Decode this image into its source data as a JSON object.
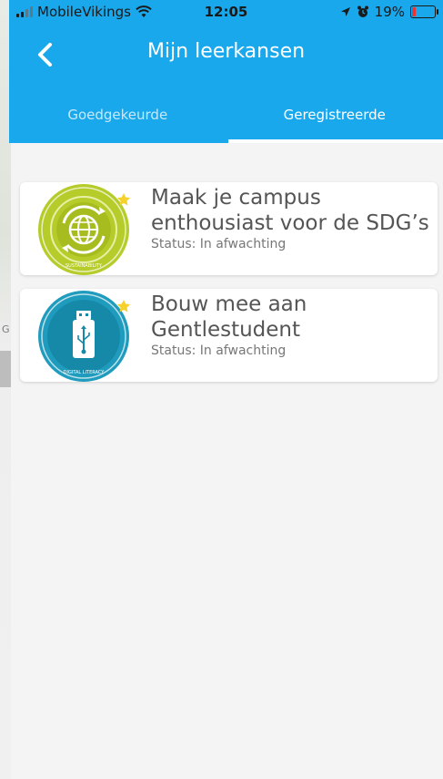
{
  "status_bar": {
    "carrier": "MobileVikings",
    "time": "12:05",
    "battery": "19%",
    "battery_level": 0.19
  },
  "header": {
    "title": "Mijn leerkansen",
    "back_icon": "chevron-left-icon",
    "accent_color": "#19a8ec"
  },
  "tabs": [
    {
      "label": "Goedgekeurde",
      "active": false
    },
    {
      "label": "Geregistreerde",
      "active": true
    }
  ],
  "items": [
    {
      "title": "Maak je campus enthousiast voor de SDG’s",
      "status": "Status: In afwachting",
      "badge_label": "SUSTAINABILITY",
      "badge_icon": "globe-recycle-icon",
      "badge_color": "#b5cc2b"
    },
    {
      "title": "Bouw mee aan Gentlestudent",
      "status": "Status: In afwachting",
      "badge_label": "DIGITAL LITERACY",
      "badge_icon": "usb-stick-icon",
      "badge_color": "#1f9bbd"
    }
  ]
}
